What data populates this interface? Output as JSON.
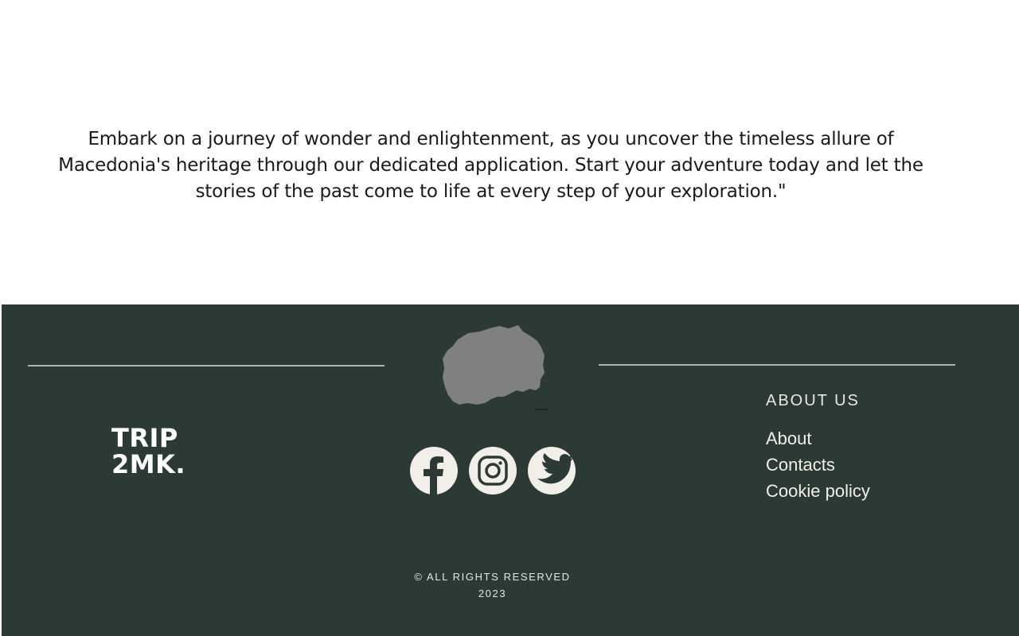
{
  "intro": {
    "text": "Embark on a journey of wonder and enlightenment, as you uncover the timeless allure of Macedonia's heritage through our dedicated application. Start your adventure today and let the stories of the past come to life at every step of your exploration.\""
  },
  "footer": {
    "logo_line1": "TRIP",
    "logo_line2": "2MK.",
    "about": {
      "title": "ABOUT US",
      "links": [
        "About",
        "Contacts",
        "Cookie policy"
      ]
    },
    "copyright_line1": "© ALL RIGHTS RESERVED",
    "copyright_line2": "2023",
    "socials": [
      "facebook-icon",
      "instagram-icon",
      "twitter-icon"
    ],
    "colors": {
      "background": "#2b3a35",
      "text": "#f2efe9",
      "map": "#808080"
    }
  }
}
